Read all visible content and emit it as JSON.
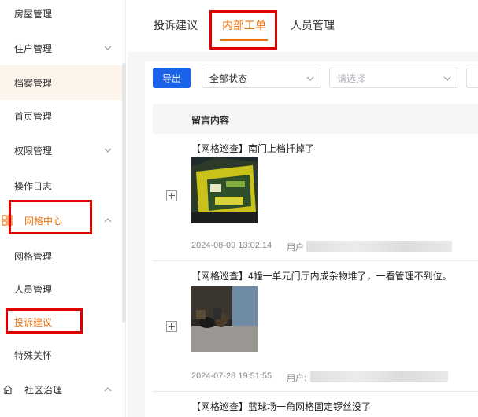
{
  "sidebar": {
    "items": [
      {
        "label": "房屋管理",
        "has_chevron": false
      },
      {
        "label": "住户管理",
        "has_chevron": true
      },
      {
        "label": "档案管理",
        "has_chevron": false
      },
      {
        "label": "首页管理",
        "has_chevron": false
      },
      {
        "label": "权限管理",
        "has_chevron": true
      },
      {
        "label": "操作日志",
        "has_chevron": false
      },
      {
        "label": "网格中心",
        "has_chevron": true
      },
      {
        "label": "网格管理",
        "has_chevron": false
      },
      {
        "label": "人员管理",
        "has_chevron": false
      },
      {
        "label": "投诉建议",
        "has_chevron": false
      },
      {
        "label": "特殊关怀",
        "has_chevron": false
      },
      {
        "label": "社区治理",
        "has_chevron": true
      }
    ]
  },
  "tabs": [
    {
      "label": "投诉建议"
    },
    {
      "label": "内部工单"
    },
    {
      "label": "人员管理"
    }
  ],
  "toolbar": {
    "export_label": "导出",
    "status_select": "全部状态",
    "second_select_placeholder": "请选择"
  },
  "table": {
    "column_header": "留言内容",
    "rows": [
      {
        "title": "【网格巡查】南门上档扦掉了",
        "date": "2024-08-09 13:02:14",
        "user_label": "用户"
      },
      {
        "title": "【网格巡查】4幢一单元门厅内成杂物堆了，一看管理不到位。",
        "date": "2024-07-28 19:51:55",
        "user_label": "用户:"
      },
      {
        "title": "【网格巡查】蓝球场一角网格固定锣丝没了"
      }
    ]
  },
  "colors": {
    "accent": "#e8730f",
    "primary_button": "#1a63e8",
    "highlight_box": "#e00000",
    "active_bg": "#fdf4ec"
  }
}
